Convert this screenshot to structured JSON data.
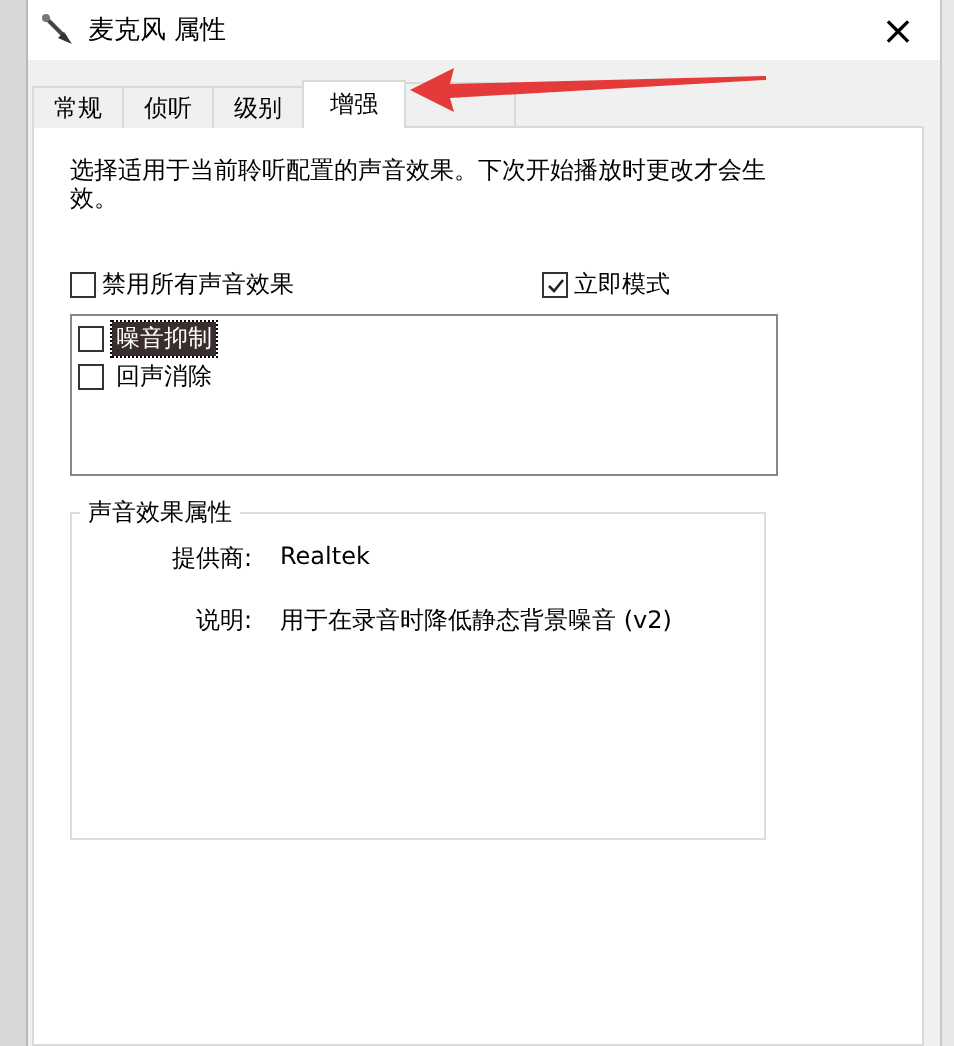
{
  "window": {
    "title": "麦克风 属性",
    "close": "×"
  },
  "tabs": [
    {
      "label": "常规",
      "selected": false
    },
    {
      "label": "侦听",
      "selected": false
    },
    {
      "label": "级别",
      "selected": false
    },
    {
      "label": "增强",
      "selected": true
    }
  ],
  "description": "选择适用于当前聆听配置的声音效果。下次开始播放时更改才会生效。",
  "options": [
    {
      "label": "禁用所有声音效果",
      "checked": false
    },
    {
      "label": "立即模式",
      "checked": true
    }
  ],
  "effects": [
    {
      "label": "噪音抑制",
      "checked": false,
      "selected": true
    },
    {
      "label": "回声消除",
      "checked": false,
      "selected": false
    }
  ],
  "properties": {
    "legend": "声音效果属性",
    "rows": [
      {
        "label": "提供商:",
        "value": "Realtek"
      },
      {
        "label": "说明:",
        "value": "用于在录音时降低静态背景噪音 (v2)"
      }
    ]
  }
}
